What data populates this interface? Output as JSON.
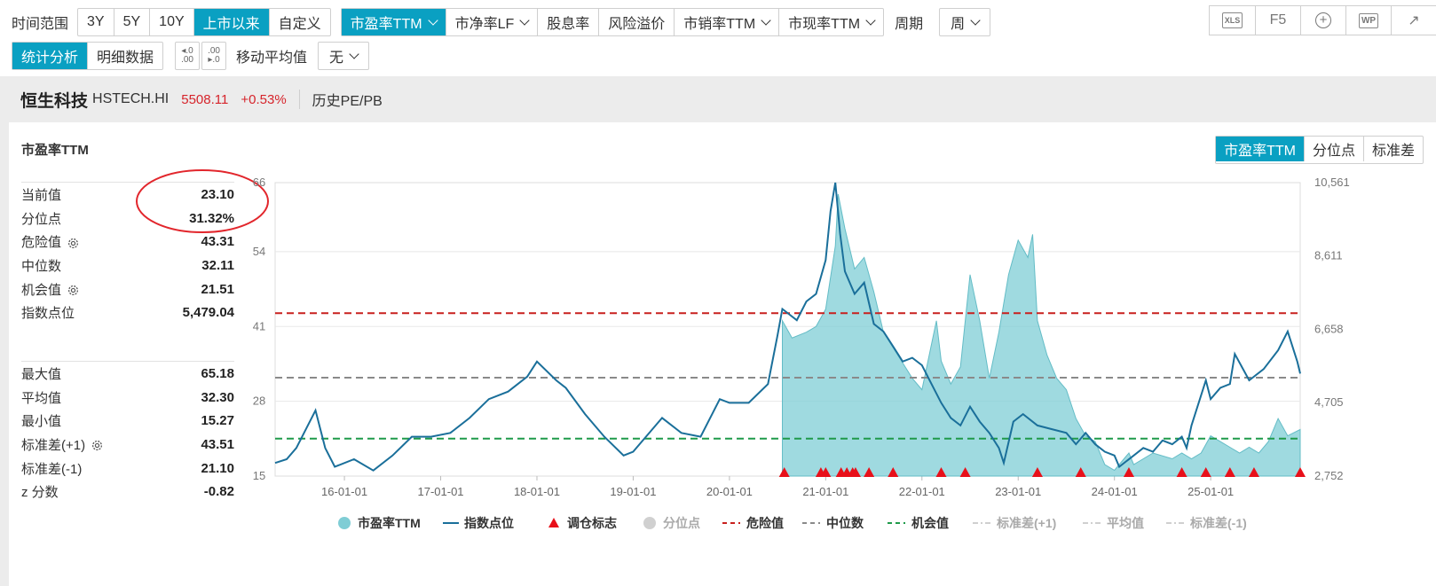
{
  "toolbar": {
    "range_label": "时间范围",
    "ranges": [
      "3Y",
      "5Y",
      "10Y",
      "上市以来",
      "自定义"
    ],
    "metrics": [
      "市盈率TTM",
      "市净率LF",
      "股息率",
      "风险溢价",
      "市销率TTM",
      "市现率TTM"
    ],
    "period_label": "周期",
    "period_value": "周",
    "tabs": [
      "统计分析",
      "明细数据"
    ],
    "ma_label": "移动平均值",
    "ma_value": "无",
    "tools": [
      "XLS",
      "F5",
      "+",
      "WP",
      "↗"
    ]
  },
  "header": {
    "name": "恒生科技",
    "code": "HSTECH.HI",
    "price": "5508.11",
    "change": "+0.53%",
    "subtitle": "历史PE/PB"
  },
  "panel": {
    "title": "市盈率TTM",
    "view_tabs": [
      "市盈率TTM",
      "分位点",
      "标准差"
    ]
  },
  "stats_top": [
    {
      "label": "当前值",
      "value": "23.10"
    },
    {
      "label": "分位点",
      "value": "31.32%"
    },
    {
      "label": "危险值",
      "value": "43.31",
      "gear": true
    },
    {
      "label": "中位数",
      "value": "32.11"
    },
    {
      "label": "机会值",
      "value": "21.51",
      "gear": true
    },
    {
      "label": "指数点位",
      "value": "5,479.04"
    }
  ],
  "stats_bottom": [
    {
      "label": "最大值",
      "value": "65.18"
    },
    {
      "label": "平均值",
      "value": "32.30"
    },
    {
      "label": "最小值",
      "value": "15.27"
    },
    {
      "label": "标准差(+1)",
      "value": "43.51",
      "gear": true
    },
    {
      "label": "标准差(-1)",
      "value": "21.10"
    },
    {
      "label": "z 分数",
      "value": "-0.82"
    }
  ],
  "chart_data": {
    "type": "area",
    "y_left_ticks": [
      "15",
      "28",
      "41",
      "54",
      "66"
    ],
    "y_left_range": [
      15,
      66
    ],
    "y_right_ticks": [
      "2,752",
      "4,705",
      "6,658",
      "8,611",
      "10,561"
    ],
    "y_right_range": [
      2752,
      10561
    ],
    "x_ticks": [
      "16-01-01",
      "17-01-01",
      "18-01-01",
      "19-01-01",
      "20-01-01",
      "21-01-01",
      "22-01-01",
      "23-01-01",
      "24-01-01",
      "25-01-01"
    ],
    "x_range": [
      2015.28,
      2025.93
    ],
    "pe_series": {
      "name": "市盈率TTM",
      "color": "#7fcdd5",
      "x": [
        2020.55,
        2020.65,
        2020.8,
        2020.9,
        2021.0,
        2021.1,
        2021.13,
        2021.2,
        2021.3,
        2021.4,
        2021.5,
        2021.6,
        2021.75,
        2021.9,
        2022.0,
        2022.15,
        2022.2,
        2022.3,
        2022.4,
        2022.5,
        2022.6,
        2022.7,
        2022.8,
        2022.9,
        2023.0,
        2023.1,
        2023.15,
        2023.2,
        2023.3,
        2023.4,
        2023.5,
        2023.6,
        2023.7,
        2023.8,
        2023.9,
        2024.0,
        2024.1,
        2024.15,
        2024.2,
        2024.4,
        2024.6,
        2024.7,
        2024.8,
        2024.9,
        2025.0,
        2025.1,
        2025.2,
        2025.3,
        2025.4,
        2025.5,
        2025.6,
        2025.7,
        2025.8,
        2025.93
      ],
      "y": [
        42,
        39,
        40,
        41,
        44,
        55,
        64,
        58,
        51,
        53,
        47,
        40,
        36,
        32,
        30,
        42,
        35,
        31,
        34,
        50,
        42,
        32,
        40,
        50,
        56,
        53,
        57,
        42,
        36,
        32,
        30,
        25,
        22,
        21,
        17,
        16,
        18,
        19,
        17,
        19,
        18,
        19,
        18,
        19,
        22,
        21,
        20,
        19,
        20,
        19,
        21,
        25,
        22,
        23.1
      ]
    },
    "index_series": {
      "name": "指数点位",
      "color": "#1a6f9a",
      "x": [
        2015.28,
        2015.4,
        2015.5,
        2015.7,
        2015.8,
        2015.9,
        2016.1,
        2016.3,
        2016.5,
        2016.7,
        2016.9,
        2017.1,
        2017.3,
        2017.5,
        2017.7,
        2017.9,
        2018.0,
        2018.2,
        2018.3,
        2018.5,
        2018.7,
        2018.9,
        2019.0,
        2019.2,
        2019.3,
        2019.5,
        2019.7,
        2019.9,
        2020.0,
        2020.2,
        2020.4,
        2020.5,
        2020.55,
        2020.7,
        2020.8,
        2020.9,
        2021.0,
        2021.05,
        2021.1,
        2021.15,
        2021.2,
        2021.3,
        2021.4,
        2021.5,
        2021.6,
        2021.7,
        2021.8,
        2021.9,
        2022.0,
        2022.1,
        2022.2,
        2022.3,
        2022.4,
        2022.5,
        2022.6,
        2022.7,
        2022.8,
        2022.85,
        2022.95,
        2023.05,
        2023.2,
        2023.35,
        2023.5,
        2023.6,
        2023.7,
        2023.8,
        2023.9,
        2024.0,
        2024.05,
        2024.2,
        2024.3,
        2024.4,
        2024.5,
        2024.6,
        2024.7,
        2024.75,
        2024.8,
        2024.95,
        2025.0,
        2025.1,
        2025.2,
        2025.25,
        2025.4,
        2025.55,
        2025.7,
        2025.8,
        2025.9,
        2025.93
      ],
      "y": [
        3100,
        3200,
        3500,
        4500,
        3500,
        3000,
        3200,
        2900,
        3300,
        3800,
        3800,
        3900,
        4300,
        4800,
        5000,
        5400,
        5800,
        5300,
        5100,
        4400,
        3800,
        3300,
        3400,
        4000,
        4300,
        3900,
        3800,
        4800,
        4700,
        4700,
        5200,
        6500,
        7200,
        6900,
        7400,
        7600,
        8500,
        9800,
        10561,
        9200,
        8200,
        7600,
        7900,
        6800,
        6600,
        6200,
        5800,
        5900,
        5700,
        5200,
        4700,
        4300,
        4100,
        4600,
        4200,
        3900,
        3500,
        3100,
        4200,
        4400,
        4100,
        4000,
        3900,
        3600,
        3900,
        3600,
        3400,
        3300,
        3000,
        3300,
        3500,
        3400,
        3700,
        3600,
        3800,
        3500,
        4100,
        5300,
        4800,
        5100,
        5200,
        6000,
        5300,
        5600,
        6100,
        6600,
        5800,
        5479
      ]
    },
    "lines": [
      {
        "name": "危险值",
        "value": 43.31,
        "color": "#c8201e"
      },
      {
        "name": "中位数",
        "value": 32.11,
        "color": "#8a8a8a"
      },
      {
        "name": "机会值",
        "value": 21.51,
        "color": "#1f9a4a"
      }
    ],
    "markers": {
      "name": "调仓标志",
      "color": "#e8101a",
      "x": [
        2020.57,
        2020.95,
        2021.0,
        2021.16,
        2021.22,
        2021.28,
        2021.31,
        2021.45,
        2021.7,
        2022.2,
        2022.45,
        2023.2,
        2023.65,
        2024.15,
        2024.7,
        2024.95,
        2025.2,
        2025.45,
        2025.93
      ]
    },
    "legend": [
      "市盈率TTM",
      "指数点位",
      "调仓标志",
      "分位点",
      "危险值",
      "中位数",
      "机会值",
      "标准差(+1)",
      "平均值",
      "标准差(-1)"
    ],
    "legend_placement": "bottom"
  }
}
